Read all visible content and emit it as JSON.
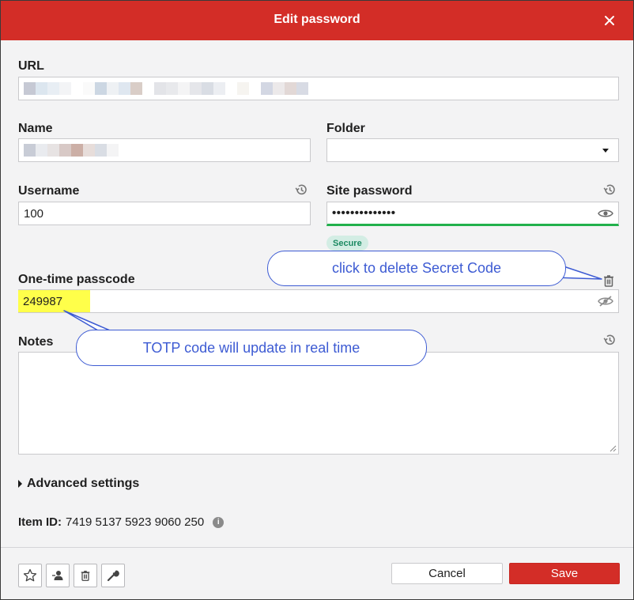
{
  "dialog": {
    "title": "Edit password",
    "close_icon": "close-icon"
  },
  "fields": {
    "url": {
      "label": "URL"
    },
    "name": {
      "label": "Name"
    },
    "folder": {
      "label": "Folder",
      "selected": ""
    },
    "username": {
      "label": "Username",
      "value": "100"
    },
    "site_password": {
      "label": "Site password",
      "masked": "••••••••••••••",
      "strength": "Secure"
    },
    "otp": {
      "label": "One-time passcode",
      "value": "249987"
    },
    "notes": {
      "label": "Notes",
      "value": ""
    }
  },
  "advanced": {
    "label": "Advanced settings"
  },
  "item_id": {
    "label": "Item ID:",
    "value": "7419 5137 5923 9060 250",
    "info": "i"
  },
  "footer": {
    "cancel_label": "Cancel",
    "save_label": "Save",
    "tools": [
      "star-icon",
      "share-icon",
      "trash-icon",
      "wrench-icon"
    ]
  },
  "annotations": {
    "delete_tip": "click to delete Secret Code",
    "totp_tip": "TOTP code will update in real time"
  },
  "colors": {
    "accent": "#d32d27",
    "secure_green": "#22b14c",
    "callout_blue": "#3d5bd3",
    "highlight": "#ffff4a"
  }
}
